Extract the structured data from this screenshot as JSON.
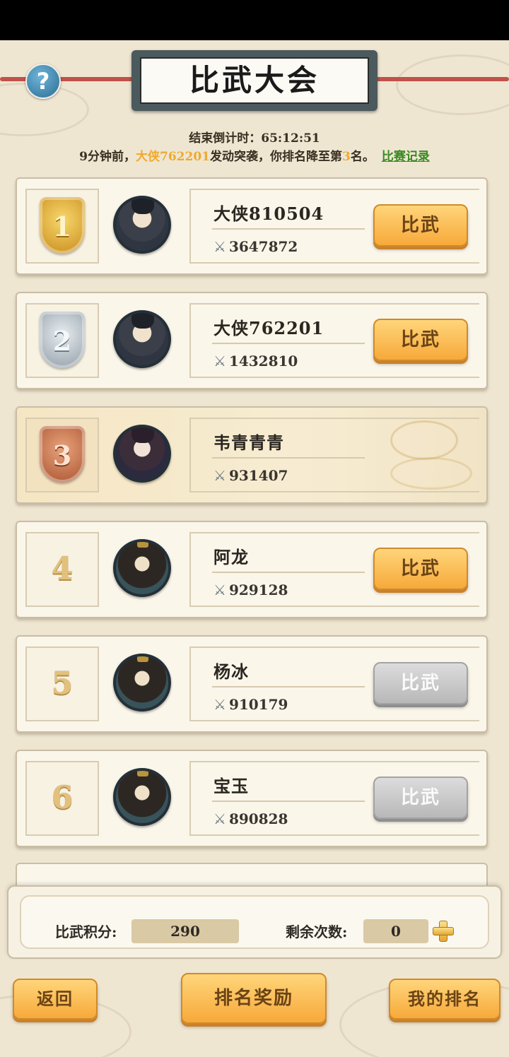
{
  "header": {
    "title": "比武大会",
    "help_glyph": "?",
    "countdown_label": "结束倒计时：",
    "countdown_value": "65:12:51",
    "notice_prefix": "9分钟前，",
    "notice_attacker": "大侠762201",
    "notice_mid": "发动突袭，你排名降至第",
    "notice_rank": "3",
    "notice_suffix": "名。",
    "record_link": "比赛记录"
  },
  "ranks": [
    {
      "rank": "1",
      "name": "大侠810504",
      "power": "3647872",
      "button": "比武",
      "button_enabled": true,
      "medal": "gold"
    },
    {
      "rank": "2",
      "name": "大侠762201",
      "power": "1432810",
      "button": "比武",
      "button_enabled": true,
      "medal": "silver"
    },
    {
      "rank": "3",
      "name": "韦青青青",
      "power": "931407",
      "button": "",
      "button_enabled": false,
      "medal": "bronze",
      "is_me": true
    },
    {
      "rank": "4",
      "name": "阿龙",
      "power": "929128",
      "button": "比武",
      "button_enabled": true
    },
    {
      "rank": "5",
      "name": "杨冰",
      "power": "910179",
      "button": "比武",
      "button_enabled": false
    },
    {
      "rank": "6",
      "name": "宝玉",
      "power": "890828",
      "button": "比武",
      "button_enabled": false
    }
  ],
  "stats": {
    "score_label": "比武积分:",
    "score_value": "290",
    "remaining_label": "剩余次数:",
    "remaining_value": "0"
  },
  "nav": {
    "back": "返回",
    "rewards": "排名奖励",
    "my_rank": "我的排名"
  },
  "colors": {
    "highlight": "#f0a92c",
    "link": "#3a8a22",
    "button_active": "#f7a93a",
    "button_disabled": "#b8b8b8"
  },
  "icons": [
    "help-icon",
    "sword-icon",
    "plus-icon",
    "medal-gold-icon",
    "medal-silver-icon",
    "medal-bronze-icon"
  ]
}
